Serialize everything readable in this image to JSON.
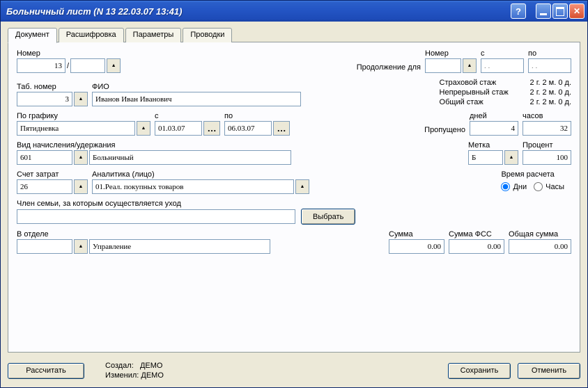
{
  "window": {
    "title": "Больничный лист (N 13 22.03.07 13:41)"
  },
  "tabs": {
    "t0": "Документ",
    "t1": "Расшифровка",
    "t2": "Параметры",
    "t3": "Проводки"
  },
  "doc": {
    "number_label": "Номер",
    "number": "13",
    "slash": "/",
    "sub": ""
  },
  "cont": {
    "label": "Продолжение для",
    "number_label": "Номер",
    "from_label": "с",
    "to_label": "по",
    "number": "",
    "from": ". .",
    "to": ". ."
  },
  "stazh": {
    "ins_label": "Страховой стаж",
    "ins_val": "2 г.  2 м.  0 д.",
    "nep_label": "Непрерывный стаж",
    "nep_val": "2 г.  2 м.  0 д.",
    "tot_label": "Общий стаж",
    "tot_val": "2 г.  2 м.  0 д."
  },
  "emp": {
    "tab_label": "Таб. номер",
    "tab": "3",
    "fio_label": "ФИО",
    "fio": "Иванов Иван Иванович"
  },
  "sched": {
    "label": "По графику",
    "value": "Пятидневка",
    "from_label": "с",
    "from": "01.03.07",
    "to_label": "по",
    "to": "06.03.07",
    "missed_label": "Пропущено",
    "days_label": "дней",
    "days": "4",
    "hours_label": "часов",
    "hours": "32"
  },
  "accrual": {
    "label": "Вид начисления/удержания",
    "code": "601",
    "name": "Больничный",
    "mark_label": "Метка",
    "mark": "Б",
    "percent_label": "Процент",
    "percent": "100"
  },
  "cost": {
    "acc_label": "Счет затрат",
    "acc": "26",
    "an_label": "Аналитика (лицо)",
    "an": "01.Реал. покупных товаров",
    "timemode_label": "Время расчета",
    "days": "Дни",
    "hours": "Часы"
  },
  "family": {
    "label": "Член семьи, за которым осуществляется уход",
    "value": "",
    "select": "Выбрать"
  },
  "dept": {
    "label": "В отделе",
    "code": "",
    "name": "Управление",
    "sum_label": "Сумма",
    "sum": "0.00",
    "fss_label": "Сумма ФСС",
    "fss": "0.00",
    "total_label": "Общая сумма",
    "total": "0.00"
  },
  "footer": {
    "calc": "Рассчитать",
    "save": "Сохранить",
    "cancel": "Отменить",
    "created_lbl": "Создал:",
    "created_val": "ДЕМО",
    "changed_lbl": "Изменил:",
    "changed_val": "ДЕМО"
  }
}
